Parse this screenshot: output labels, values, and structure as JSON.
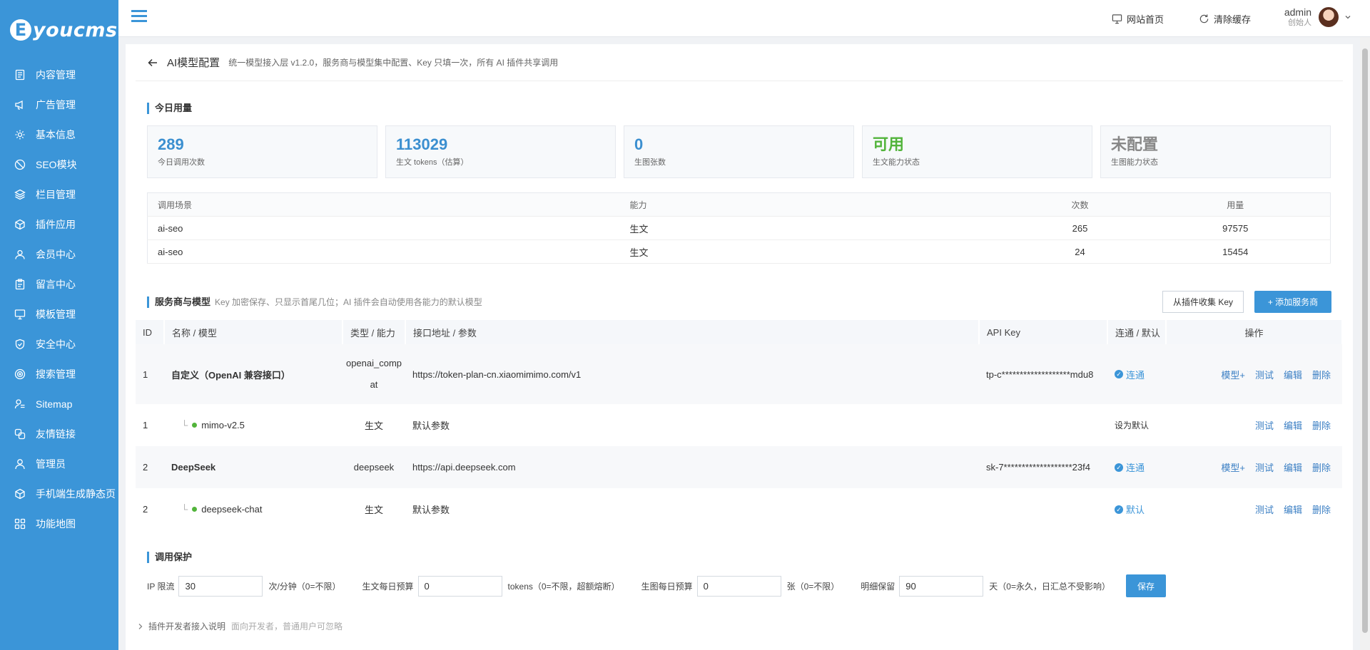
{
  "brand": {
    "mark": "E",
    "name": "youcms"
  },
  "sidebar": {
    "items": [
      {
        "label": "内容管理",
        "icon": "document-icon"
      },
      {
        "label": "广告管理",
        "icon": "megaphone-icon"
      },
      {
        "label": "基本信息",
        "icon": "gear-icon"
      },
      {
        "label": "SEO模块",
        "icon": "seo-icon"
      },
      {
        "label": "栏目管理",
        "icon": "layers-icon"
      },
      {
        "label": "插件应用",
        "icon": "cube-icon"
      },
      {
        "label": "会员中心",
        "icon": "user-icon"
      },
      {
        "label": "留言中心",
        "icon": "clipboard-icon"
      },
      {
        "label": "模板管理",
        "icon": "monitor-icon"
      },
      {
        "label": "安全中心",
        "icon": "shield-icon"
      },
      {
        "label": "搜索管理",
        "icon": "target-icon"
      },
      {
        "label": "Sitemap",
        "icon": "sitemap-icon"
      },
      {
        "label": "友情链接",
        "icon": "link-icon"
      },
      {
        "label": "管理员",
        "icon": "admin-icon"
      },
      {
        "label": "手机端生成静态页",
        "icon": "mobile-cube-icon"
      },
      {
        "label": "功能地图",
        "icon": "grid-icon"
      }
    ]
  },
  "header": {
    "site_home": "网站首页",
    "clear_cache": "清除缓存",
    "user_name": "admin",
    "user_role": "创始人"
  },
  "page": {
    "title": "AI模型配置",
    "subtitle": "统一模型接入层 v1.2.0，服务商与模型集中配置、Key 只填一次，所有 AI 插件共享调用"
  },
  "usage_section": {
    "title": "今日用量",
    "stats": [
      {
        "value": "289",
        "label": "今日调用次数"
      },
      {
        "value": "113029",
        "label": "生文 tokens（估算）"
      },
      {
        "value": "0",
        "label": "生图张数"
      },
      {
        "value": "可用",
        "label": "生文能力状态"
      },
      {
        "value": "未配置",
        "label": "生图能力状态"
      }
    ],
    "columns": [
      "调用场景",
      "能力",
      "次数",
      "用量"
    ],
    "rows": [
      {
        "scene": "ai-seo",
        "ability": "生文",
        "count": "265",
        "amount": "97575"
      },
      {
        "scene": "ai-seo",
        "ability": "生文",
        "count": "24",
        "amount": "15454"
      }
    ]
  },
  "providers_section": {
    "title": "服务商与模型",
    "note": "Key 加密保存、只显示首尾几位；AI 插件会自动使用各能力的默认模型",
    "collect_button": "从插件收集 Key",
    "add_button": "+ 添加服务商",
    "columns": [
      "ID",
      "名称 / 模型",
      "类型 / 能力",
      "接口地址 / 参数",
      "API Key",
      "连通 / 默认",
      "操作"
    ],
    "rows": [
      {
        "id": "1",
        "name": "自定义（OpenAI 兼容接口）",
        "type_line1": "openai_comp",
        "type_line2": "at",
        "endpoint": "https://token-plan-cn.xiaomimimo.com/v1",
        "key": "tp-c*******************mdu8",
        "status": "连通",
        "ops": [
          "模型+",
          "测试",
          "编辑",
          "删除"
        ]
      },
      {
        "id": "1",
        "name": "mimo-v2.5",
        "type": "生文",
        "endpoint": "默认参数",
        "key": "",
        "status": "设为默认",
        "ops": [
          "测试",
          "编辑",
          "删除"
        ]
      },
      {
        "id": "2",
        "name": "DeepSeek",
        "type": "deepseek",
        "endpoint": "https://api.deepseek.com",
        "key": "sk-7*******************23f4",
        "status": "连通",
        "ops": [
          "模型+",
          "测试",
          "编辑",
          "删除"
        ]
      },
      {
        "id": "2",
        "name": "deepseek-chat",
        "type": "生文",
        "endpoint": "默认参数",
        "key": "",
        "status": "默认",
        "ops": [
          "测试",
          "编辑",
          "删除"
        ]
      }
    ]
  },
  "guard_section": {
    "title": "调用保护",
    "ip_label": "IP 限流",
    "ip_value": "30",
    "ip_unit": "次/分钟（0=不限）",
    "text_label": "生文每日预算",
    "text_value": "0",
    "text_unit": "tokens（0=不限，超额熔断）",
    "image_label": "生图每日预算",
    "image_value": "0",
    "image_unit": "张（0=不限）",
    "detail_label": "明细保留",
    "detail_value": "90",
    "detail_unit": "天（0=永久，日汇总不受影响）",
    "save_button": "保存"
  },
  "footer": {
    "title": "插件开发者接入说明",
    "note": "面向开发者，普通用户可忽略"
  }
}
